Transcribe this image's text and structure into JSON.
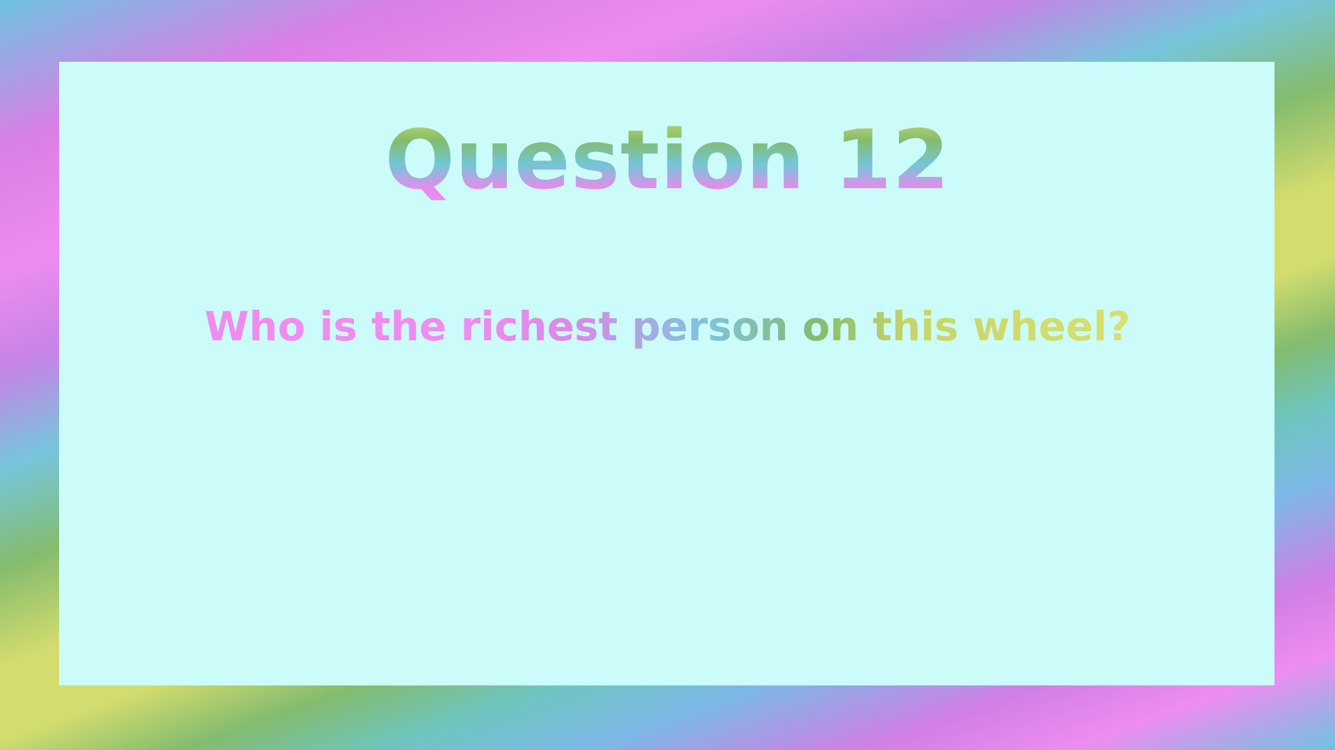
{
  "slide": {
    "title": "Question 12",
    "question": "Who is the richest person on this wheel?"
  },
  "colors": {
    "panel_background": "#ccfcfa",
    "border_pink": "#ee8cf0",
    "border_blue": "#6ec3e0",
    "border_green": "#84bc6e",
    "border_yellow": "#d3dc6e"
  }
}
